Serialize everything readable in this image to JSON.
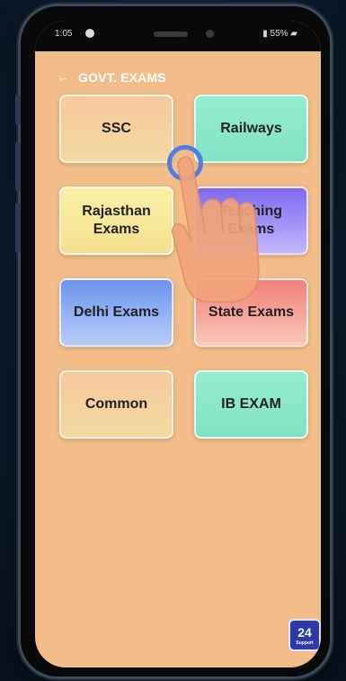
{
  "status_bar": {
    "time": "1:05",
    "battery": "55%"
  },
  "header": {
    "back_icon": "←",
    "title": "GOVT. EXAMS"
  },
  "tiles": [
    {
      "label": "SSC"
    },
    {
      "label": "Railways"
    },
    {
      "label": "Rajasthan\nExams"
    },
    {
      "label": "Teaching\nExams"
    },
    {
      "label": "Delhi Exams"
    },
    {
      "label": "State Exams"
    },
    {
      "label": "Common"
    },
    {
      "label": "IB EXAM"
    }
  ],
  "logo": {
    "number": "24",
    "sub": "Support"
  },
  "colors": {
    "screen_background": "#f2bd88",
    "header_text": "#ffffff",
    "touch_ring": "#4d7fe6"
  }
}
